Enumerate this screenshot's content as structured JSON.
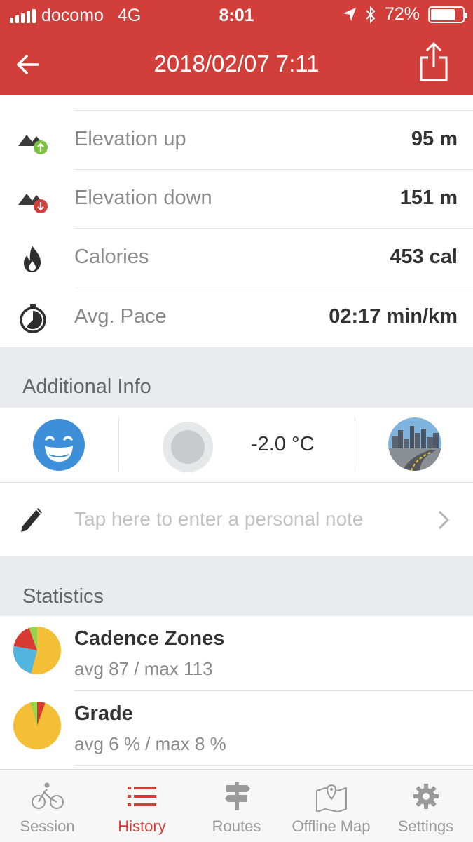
{
  "status_bar": {
    "carrier": "docomo",
    "network": "4G",
    "time": "8:01",
    "battery": "72%"
  },
  "nav": {
    "title": "2018/02/07 7:11"
  },
  "metrics": [
    {
      "label": "Elevation up",
      "value": "95 m",
      "icon": "elevation-up-icon"
    },
    {
      "label": "Elevation down",
      "value": "151 m",
      "icon": "elevation-down-icon"
    },
    {
      "label": "Calories",
      "value": "453 cal",
      "icon": "flame-icon"
    },
    {
      "label": "Avg. Pace",
      "value": "02:17 min/km",
      "icon": "stopwatch-icon"
    }
  ],
  "additional_info": {
    "header": "Additional Info",
    "temperature": "-2.0 °C",
    "note_placeholder": "Tap here to enter a personal note"
  },
  "statistics": {
    "header": "Statistics",
    "items": [
      {
        "title": "Cadence Zones",
        "subtitle": "avg 87 / max 113"
      },
      {
        "title": "Grade",
        "subtitle": "avg 6 % / max 8 %"
      }
    ]
  },
  "tabs": [
    {
      "label": "Session",
      "icon": "bike-icon",
      "active": false
    },
    {
      "label": "History",
      "icon": "list-icon",
      "active": true
    },
    {
      "label": "Routes",
      "icon": "signpost-icon",
      "active": false
    },
    {
      "label": "Offline Map",
      "icon": "map-icon",
      "active": false
    },
    {
      "label": "Settings",
      "icon": "gear-icon",
      "active": false
    }
  ],
  "colors": {
    "accent": "#d23f3a",
    "section_bg": "#e9ebee",
    "tab_inactive": "#9a9a9a"
  }
}
